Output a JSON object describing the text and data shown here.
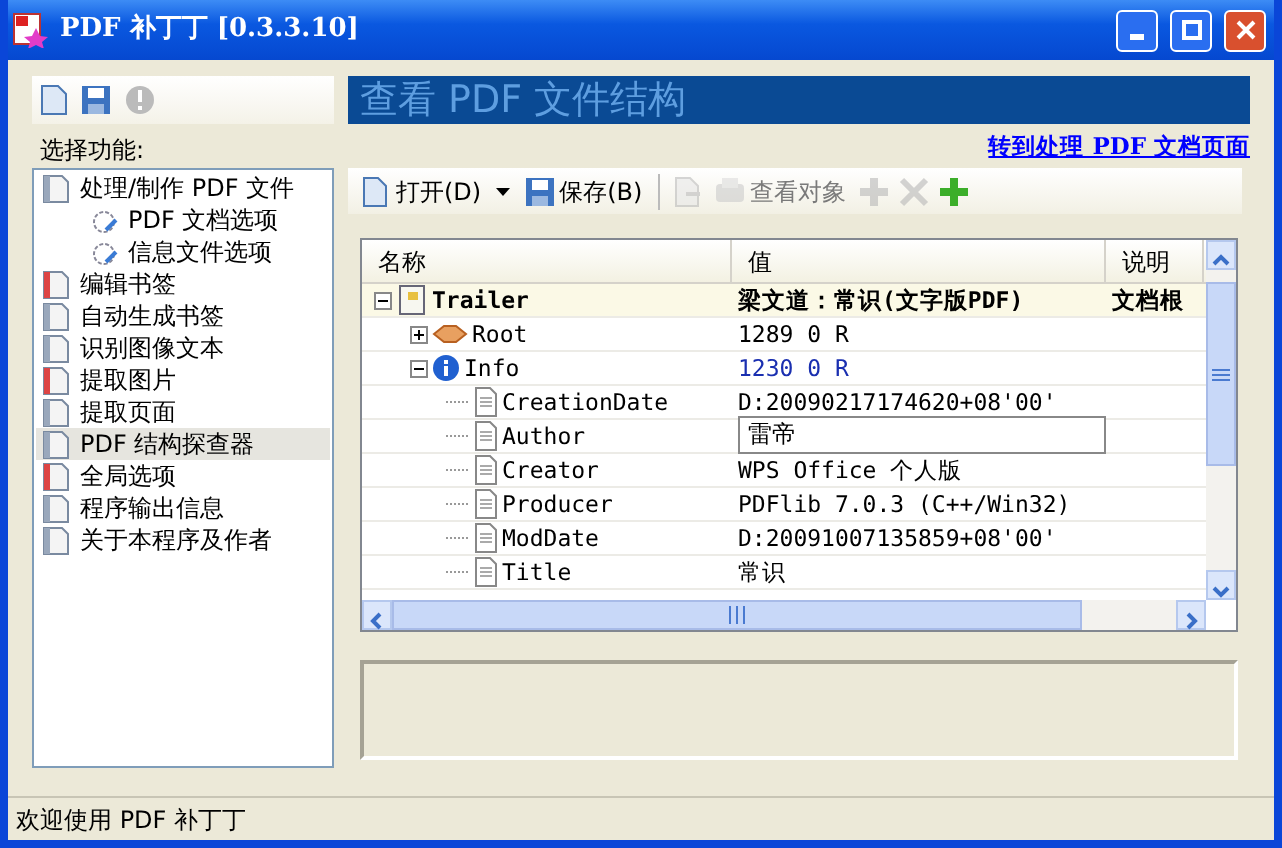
{
  "window": {
    "title": "PDF 补丁丁 [0.3.3.10]"
  },
  "header": {
    "title": "查看 PDF 文件结构",
    "link": "转到处理 PDF 文档页面"
  },
  "sidebar": {
    "label": "选择功能:",
    "items": [
      {
        "label": "处理/制作 PDF 文件",
        "selected": false,
        "children": [
          {
            "label": "PDF 文档选项",
            "selected": false
          },
          {
            "label": "信息文件选项",
            "selected": false
          }
        ]
      },
      {
        "label": "编辑书签",
        "selected": false
      },
      {
        "label": "自动生成书签",
        "selected": false
      },
      {
        "label": "识别图像文本",
        "selected": false
      },
      {
        "label": "提取图片",
        "selected": false
      },
      {
        "label": "提取页面",
        "selected": false
      },
      {
        "label": "PDF 结构探查器",
        "selected": true
      },
      {
        "label": "全局选项",
        "selected": false
      },
      {
        "label": "程序输出信息",
        "selected": false
      },
      {
        "label": "关于本程序及作者",
        "selected": false
      }
    ]
  },
  "toolbar": [
    {
      "kind": "button",
      "label": "打开(D)",
      "disabled": false,
      "dropdown": true
    },
    {
      "kind": "button",
      "label": "保存(B)",
      "disabled": false
    },
    {
      "kind": "separator"
    },
    {
      "kind": "icon",
      "disabled": true
    },
    {
      "kind": "button",
      "label": "查看对象",
      "disabled": true
    },
    {
      "kind": "plus",
      "disabled": true
    },
    {
      "kind": "delete",
      "disabled": true
    },
    {
      "kind": "plus",
      "disabled": false
    }
  ],
  "tree": {
    "columns": [
      "名称",
      "值",
      "说明"
    ],
    "rows": [
      {
        "name": "Trailer",
        "value": "梁文道：常识(文字版PDF)",
        "description": "文档根",
        "selected": true,
        "expanded": true,
        "children": [
          {
            "name": "Root",
            "value": "1289 0 R",
            "selected": false,
            "expanded": false
          },
          {
            "name": "Info",
            "value": "1230 0 R",
            "selected": false,
            "expanded": true,
            "children": [
              {
                "name": "CreationDate",
                "value": "D:20090217174620+08'00'",
                "selected": false
              },
              {
                "name": "Author",
                "value": "雷帝",
                "selected": false,
                "editing": true
              },
              {
                "name": "Creator",
                "value": "WPS Office 个人版",
                "selected": false
              },
              {
                "name": "Producer",
                "value": "PDFlib 7.0.3 (C++/Win32)",
                "selected": false
              },
              {
                "name": "ModDate",
                "value": "D:20091007135859+08'00'",
                "selected": false
              },
              {
                "name": "Title",
                "value": "常识",
                "selected": false
              }
            ]
          }
        ]
      }
    ]
  },
  "status_bar": "欢迎使用 PDF 补丁丁"
}
